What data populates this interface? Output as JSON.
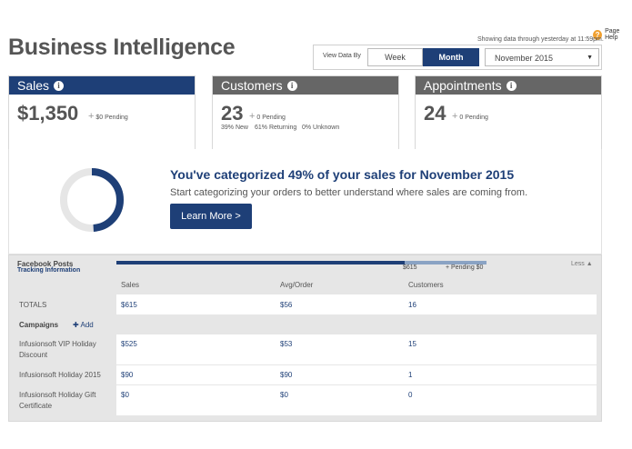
{
  "header": {
    "title": "Business Intelligence",
    "page_help": "Page Help",
    "help_icon": "?",
    "showing": "Showing data through yesterday at 11:59pm."
  },
  "view_controls": {
    "label": "View Data By",
    "week": "Week",
    "month": "Month",
    "selected_period": "November 2015",
    "selected_tab": "Month"
  },
  "cards": {
    "sales": {
      "title": "Sales",
      "value": "$1,350",
      "pending": "$0 Pending"
    },
    "customers": {
      "title": "Customers",
      "value": "23",
      "pending": "0 Pending",
      "new": "39% New",
      "returning": "61% Returning",
      "unknown": "0% Unknown"
    },
    "appointments": {
      "title": "Appointments",
      "value": "24",
      "pending": "0 Pending"
    }
  },
  "categorize": {
    "title": "You've categorized 49% of your sales for November 2015",
    "subtitle": "Start categorizing your orders to better understand where sales are coming from.",
    "button": "Learn More >",
    "percent": 49
  },
  "detail": {
    "source_title": "Facebook Posts",
    "source_link": "Tracking Information",
    "bar_value": "$615",
    "bar_pending": "+ Pending $0",
    "bar_fill_fraction": 0.78,
    "less": "Less",
    "columns": [
      "Sales",
      "Avg/Order",
      "Customers"
    ],
    "totals": {
      "label": "TOTALS",
      "sales": "$615",
      "avg": "$56",
      "customers": "16"
    },
    "campaigns_label": "Campaigns",
    "add_label": "Add",
    "rows": [
      {
        "label": "Infusionsoft VIP Holiday Discount",
        "sales": "$525",
        "avg": "$53",
        "customers": "15"
      },
      {
        "label": "Infusionsoft Holiday 2015",
        "sales": "$90",
        "avg": "$90",
        "customers": "1"
      },
      {
        "label": "Infusionsoft Holiday Gift Certificate",
        "sales": "$0",
        "avg": "$0",
        "customers": "0"
      }
    ]
  },
  "colors": {
    "accent": "#1e3f77",
    "card_gray": "#666666",
    "help": "#f0a030"
  }
}
